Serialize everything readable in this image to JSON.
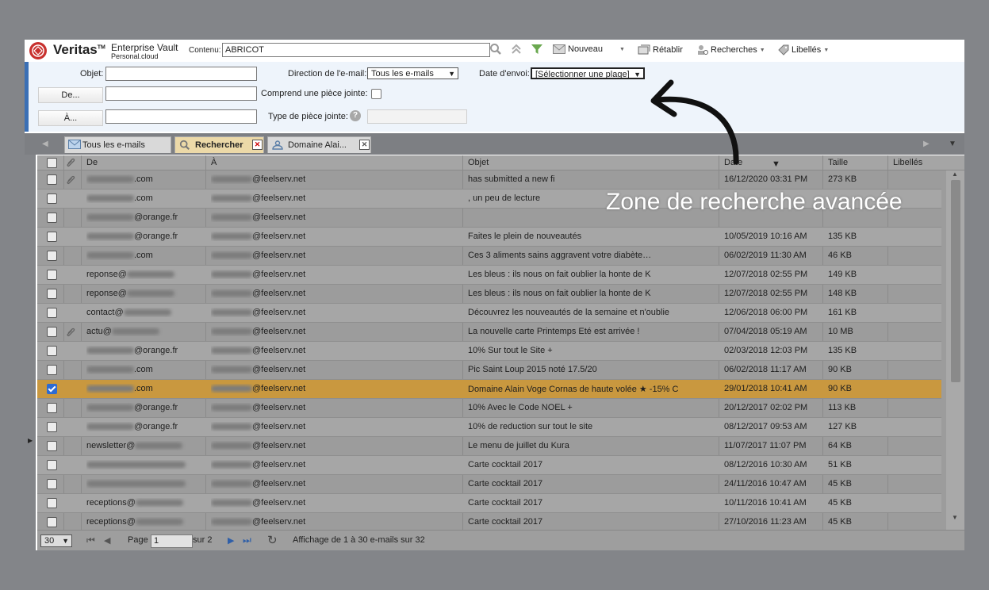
{
  "brand": {
    "name": "Veritas",
    "tm": "TM",
    "product_line1": "Enterprise Vault",
    "product_line2": "Personal.cloud"
  },
  "toolbar": {
    "content_label": "Contenu:",
    "content_value": "ABRICOT",
    "new_label": "Nouveau",
    "restore_label": "Rétablir",
    "searches_label": "Recherches",
    "labels_label": "Libellés"
  },
  "filter": {
    "subject_label": "Objet:",
    "from_button": "De...",
    "to_button": "À...",
    "direction_label": "Direction de l'e-mail:",
    "direction_value": "Tous les e-mails",
    "attachment_label": "Comprend une pièce jointe:",
    "attachment_type_label": "Type de pièce jointe:",
    "date_label": "Date d'envoi:",
    "date_value": "[Sélectionner une plage]"
  },
  "tabs": [
    {
      "label": "Tous les e-mails"
    },
    {
      "label": "Rechercher"
    },
    {
      "label": "Domaine Alai..."
    }
  ],
  "columns": {
    "from": "De",
    "to": "À",
    "subject": "Objet",
    "date": "Date",
    "size": "Taille",
    "labels": "Libellés"
  },
  "rows": [
    {
      "from": ".com",
      "to": "@feelserv.net",
      "subject": "has submitted a new fi",
      "date": "16/12/2020 03:31 PM",
      "size": "273 KB",
      "attach": true
    },
    {
      "from": ".com",
      "to": "@feelserv.net",
      "subject": ", un peu de lecture",
      "date": "",
      "size": "",
      "attach": false
    },
    {
      "from": "@orange.fr",
      "to": "@feelserv.net",
      "subject": "",
      "date": "",
      "size": "",
      "attach": false
    },
    {
      "from": "@orange.fr",
      "to": "@feelserv.net",
      "subject": "Faites le plein de nouveautés",
      "date": "10/05/2019 10:16 AM",
      "size": "135 KB",
      "attach": false
    },
    {
      "from": ".com",
      "to": "@feelserv.net",
      "subject": "Ces 3 aliments sains aggravent votre diabète…",
      "date": "06/02/2019 11:30 AM",
      "size": "46 KB",
      "attach": false
    },
    {
      "from": "reponse@",
      "to": "@feelserv.net",
      "subject": "Les bleus : ils nous on fait oublier la honte de K",
      "date": "12/07/2018 02:55 PM",
      "size": "149 KB",
      "attach": false
    },
    {
      "from": "reponse@",
      "to": "@feelserv.net",
      "subject": "Les bleus : ils nous on fait oublier la honte de K",
      "date": "12/07/2018 02:55 PM",
      "size": "148 KB",
      "attach": false
    },
    {
      "from": "contact@",
      "to": "@feelserv.net",
      "subject": "Découvrez les nouveautés de la semaine et n'oublie",
      "date": "12/06/2018 06:00 PM",
      "size": "161 KB",
      "attach": false
    },
    {
      "from": "actu@",
      "to": "@feelserv.net",
      "subject": "La nouvelle carte Printemps Eté est arrivée !",
      "date": "07/04/2018 05:19 AM",
      "size": "10 MB",
      "attach": true
    },
    {
      "from": "@orange.fr",
      "to": "@feelserv.net",
      "subject": "10% Sur tout le Site +",
      "date": "02/03/2018 12:03 PM",
      "size": "135 KB",
      "attach": false
    },
    {
      "from": ".com",
      "to": "@feelserv.net",
      "subject": "Pic Saint Loup 2015 noté 17.5/20",
      "date": "06/02/2018 11:17 AM",
      "size": "90 KB",
      "attach": false
    },
    {
      "from": ".com",
      "to": "@feelserv.net",
      "subject": "Domaine Alain Voge Cornas de haute volée ★ -15% C",
      "date": "29/01/2018 10:41 AM",
      "size": "90 KB",
      "attach": false,
      "selected": true
    },
    {
      "from": "@orange.fr",
      "to": "@feelserv.net",
      "subject": "10% Avec le Code NOEL +",
      "date": "20/12/2017 02:02 PM",
      "size": "113 KB",
      "attach": false
    },
    {
      "from": "@orange.fr",
      "to": "@feelserv.net",
      "subject": "10% de reduction sur tout le site",
      "date": "08/12/2017 09:53 AM",
      "size": "127 KB",
      "attach": false
    },
    {
      "from": "newsletter@",
      "to": "@feelserv.net",
      "subject": "Le menu de juillet du Kura",
      "date": "11/07/2017 11:07 PM",
      "size": "64 KB",
      "attach": false
    },
    {
      "from": "",
      "to": "@feelserv.net",
      "subject": "Carte cocktail 2017",
      "date": "08/12/2016 10:30 AM",
      "size": "51 KB",
      "attach": false
    },
    {
      "from": "",
      "to": "@feelserv.net",
      "subject": "Carte cocktail 2017",
      "date": "24/11/2016 10:47 AM",
      "size": "45 KB",
      "attach": false
    },
    {
      "from": "receptions@",
      "to": "@feelserv.net",
      "subject": "Carte cocktail 2017",
      "date": "10/11/2016 10:41 AM",
      "size": "45 KB",
      "attach": false
    },
    {
      "from": "receptions@",
      "to": "@feelserv.net",
      "subject": "Carte cocktail 2017",
      "date": "27/10/2016 11:23 AM",
      "size": "45 KB",
      "attach": false
    }
  ],
  "footer": {
    "page_size": "30",
    "page_label": "Page",
    "page_value": "1",
    "page_total": "sur 2",
    "status": "Affichage de 1 à 30 e-mails sur 32"
  },
  "annotation": "Zone de recherche avancée"
}
